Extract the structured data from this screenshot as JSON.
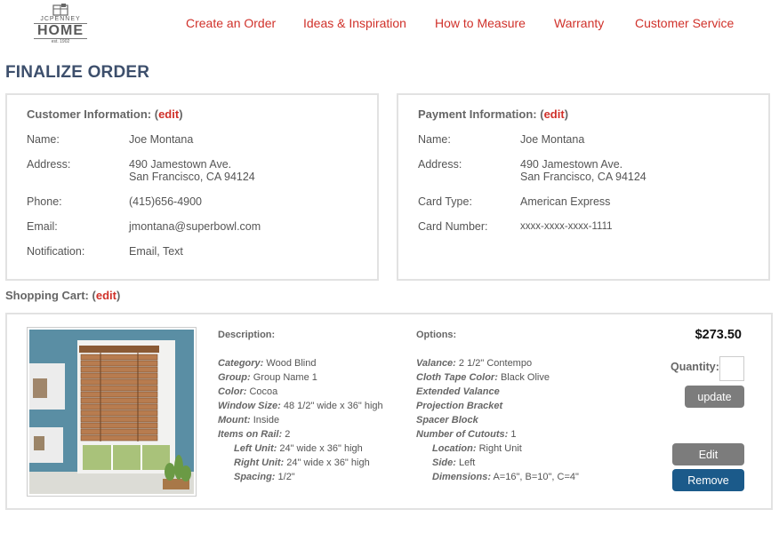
{
  "brand": {
    "line1": "JCPENNEY",
    "line2": "HOME",
    "line3": "est. 1902"
  },
  "nav": [
    "Create an Order",
    "Ideas & Inspiration",
    "How to Measure",
    "Warranty",
    "Customer Service"
  ],
  "page_title": "FINALIZE ORDER",
  "customer": {
    "title": "Customer Information:",
    "edit": "edit",
    "name_label": "Name:",
    "name": "Joe Montana",
    "address_label": "Address:",
    "address1": "490 Jamestown Ave.",
    "address2": "San Francisco, CA 94124",
    "phone_label": "Phone:",
    "phone": "(415)656-4900",
    "email_label": "Email:",
    "email": "jmontana@superbowl.com",
    "notification_label": "Notification:",
    "notification": "Email, Text"
  },
  "payment": {
    "title": "Payment Information:",
    "edit": "edit",
    "name_label": "Name:",
    "name": "Joe Montana",
    "address_label": "Address:",
    "address1": "490 Jamestown Ave.",
    "address2": "San Francisco, CA 94124",
    "card_type_label": "Card Type:",
    "card_type": "American Express",
    "card_number_label": "Card Number:",
    "card_number": "xxxx-xxxx-xxxx-1111"
  },
  "cart": {
    "title": "Shopping Cart:",
    "edit": "edit",
    "description_head": "Description:",
    "options_head": "Options:",
    "description": {
      "category_k": "Category:",
      "category_v": "Wood Blind",
      "group_k": "Group:",
      "group_v": "Group Name 1",
      "color_k": "Color:",
      "color_v": "Cocoa",
      "window_k": "Window Size:",
      "window_v": "48 1/2\" wide x 36\" high",
      "mount_k": "Mount:",
      "mount_v": "Inside",
      "items_k": "Items on Rail:",
      "items_v": "2",
      "left_k": "Left Unit:",
      "left_v": "24\" wide x 36\" high",
      "right_k": "Right Unit:",
      "right_v": "24\" wide x 36\" high",
      "spacing_k": "Spacing:",
      "spacing_v": "1/2\""
    },
    "options": {
      "valance_k": "Valance:",
      "valance_v": "2 1/2\" Contempo",
      "tape_k": "Cloth Tape Color:",
      "tape_v": "Black Olive",
      "extended": "Extended Valance",
      "projection": "Projection Bracket",
      "spacer": "Spacer Block",
      "cutouts_k": "Number of Cutouts:",
      "cutouts_v": "1",
      "location_k": "Location:",
      "location_v": "Right Unit",
      "side_k": "Side:",
      "side_v": "Left",
      "dims_k": "Dimensions:",
      "dims_v": "A=16\", B=10\", C=4\""
    },
    "price": "$273.50",
    "quantity_label": "Quantity:",
    "quantity_value": "",
    "update_label": "update",
    "edit_label": "Edit",
    "remove_label": "Remove"
  },
  "colors": {
    "accent": "#d0312a",
    "title": "#3d4f6c",
    "remove": "#1b5a8a",
    "button_gray": "#7c7c7c"
  },
  "icons": [
    "jcpenney-home-logo"
  ]
}
